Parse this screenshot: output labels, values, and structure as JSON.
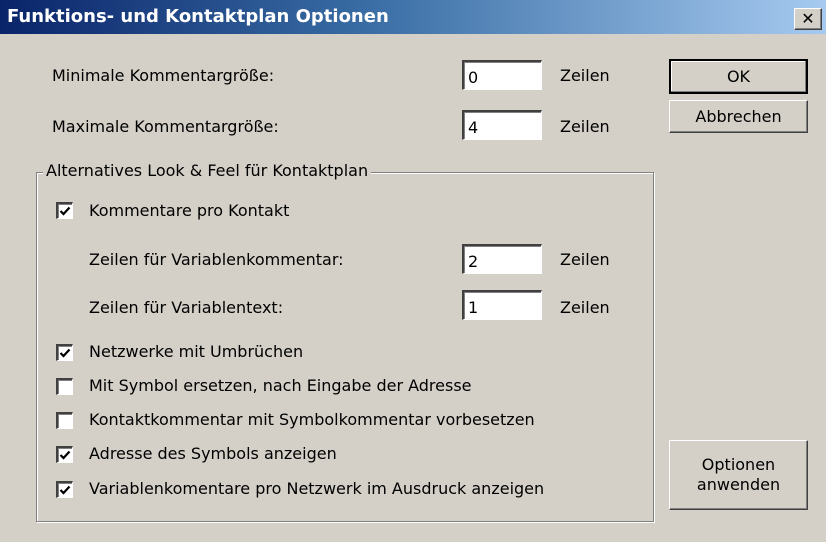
{
  "window": {
    "title": "Funktions- und Kontaktplan Optionen",
    "close_glyph": "✕"
  },
  "comment_size": {
    "min_label": "Minimale Kommentargröße:",
    "min_value": "0",
    "max_label": "Maximale Kommentargröße:",
    "max_value": "4",
    "unit": "Zeilen"
  },
  "buttons": {
    "ok": "OK",
    "cancel": "Abbrechen",
    "apply_line1": "Optionen",
    "apply_line2": "anwenden"
  },
  "group": {
    "legend": "Alternatives Look & Feel für Kontaktplan",
    "comments_per_contact": {
      "label": "Kommentare pro Kontakt",
      "checked": true
    },
    "var_comment_lines": {
      "label": "Zeilen für Variablenkommentar:",
      "value": "2",
      "unit": "Zeilen"
    },
    "var_text_lines": {
      "label": "Zeilen für Variablentext:",
      "value": "1",
      "unit": "Zeilen"
    },
    "options": [
      {
        "label": "Netzwerke mit Umbrüchen",
        "checked": true
      },
      {
        "label": "Mit Symbol ersetzen, nach Eingabe der Adresse",
        "checked": false
      },
      {
        "label": "Kontaktkommentar mit Symbolkommentar vorbesetzen",
        "checked": false
      },
      {
        "label": "Adresse des Symbols anzeigen",
        "checked": true
      },
      {
        "label": "Variablenkomentare pro Netzwerk im Ausdruck anzeigen",
        "checked": true
      }
    ]
  }
}
